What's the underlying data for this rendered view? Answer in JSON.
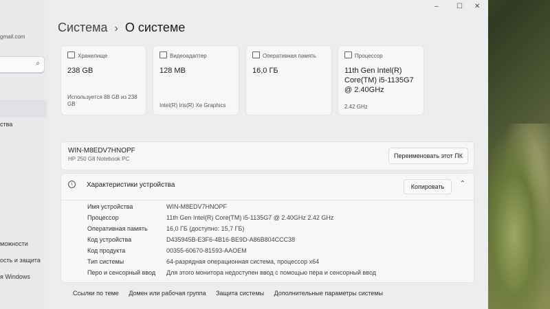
{
  "window": {
    "minimize": "–",
    "maximize": "☐",
    "close": "✕"
  },
  "breadcrumb": {
    "parent": "Система",
    "separator": "›",
    "current": "О системе"
  },
  "sidebar": {
    "account_fragment": "gmail.com",
    "search_icon": "search-icon",
    "items": [
      {
        "label": "ства"
      },
      {
        "label": "можности"
      },
      {
        "label": "ость и защита"
      },
      {
        "label": "я Windows"
      }
    ]
  },
  "cards": [
    {
      "icon": "storage-icon",
      "title": "Хранилище",
      "value": "238 GB",
      "sub": "Используется 88 GB из 238 GB"
    },
    {
      "icon": "gpu-icon",
      "title": "Видеоадаптер",
      "value": "128 MB",
      "sub": "Intel(R) Iris(R) Xe Graphics"
    },
    {
      "icon": "ram-icon",
      "title": "Оперативная память",
      "value": "16,0 ГБ",
      "sub": ""
    },
    {
      "icon": "cpu-icon",
      "title": "Процессор",
      "value": "11th Gen Intel(R) Core(TM) i5-1135G7 @ 2.40GHz",
      "sub": "2.42 GHz"
    }
  ],
  "pc": {
    "name": "WIN-M8EDV7HNOPF",
    "model": "HP 250 G8 Notebook PC",
    "rename_label": "Переименовать этот ПК"
  },
  "specs": {
    "title": "Характеристики устройства",
    "copy_label": "Копировать",
    "rows": [
      {
        "k": "Имя устройства",
        "v": "WIN-M8EDV7HNOPF"
      },
      {
        "k": "Процессор",
        "v": "11th Gen Intel(R) Core(TM) i5-1135G7 @ 2.40GHz   2.42 GHz"
      },
      {
        "k": "Оперативная память",
        "v": "16,0 ГБ (доступно: 15,7 ГБ)"
      },
      {
        "k": "Код устройства",
        "v": "D435945B-E3F6-4B16-BE9D-A86B804CCC38"
      },
      {
        "k": "Код продукта",
        "v": "00355-60670-81593-AAOEM"
      },
      {
        "k": "Тип системы",
        "v": "64-разрядная операционная система, процессор x64"
      },
      {
        "k": "Перо и сенсорный ввод",
        "v": "Для этого монитора недоступен ввод с помощью пера и сенсорный ввод"
      }
    ]
  },
  "links": [
    "Ссылки по теме",
    "Домен или рабочая группа",
    "Защита системы",
    "Дополнительные параметры системы"
  ]
}
